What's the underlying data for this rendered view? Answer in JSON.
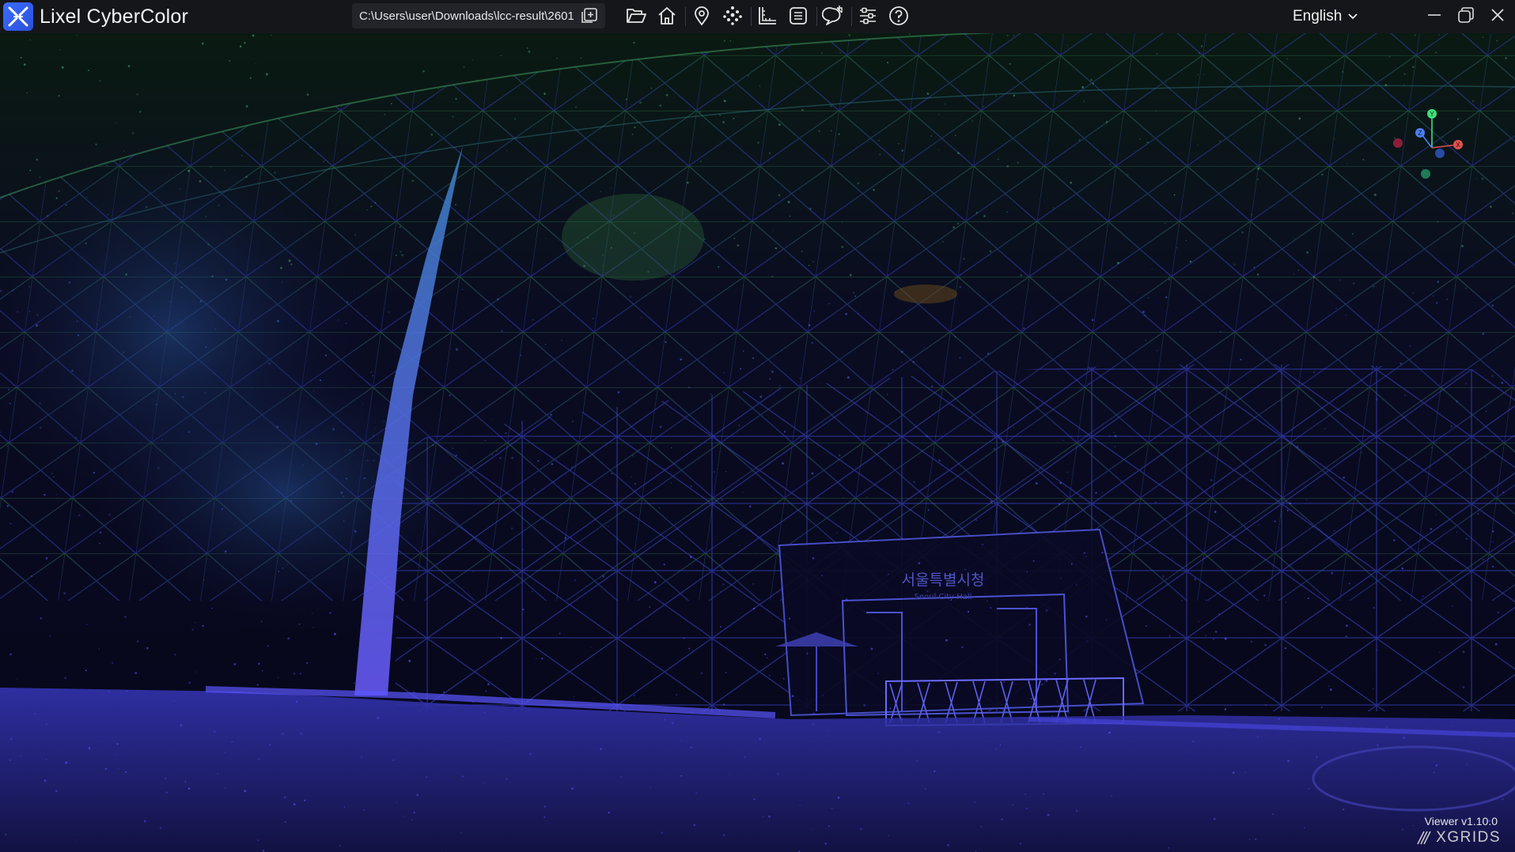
{
  "app": {
    "title": "Lixel CyberColor",
    "path": "C:\\Users\\user\\Downloads\\lcc-result\\2601",
    "language": "English"
  },
  "toolbar": {
    "icons": [
      "folder-open-icon",
      "home-icon",
      "location-pin-icon",
      "point-cloud-icon",
      "measure-ruler-icon",
      "list-icon",
      "chat-bubble-icon",
      "settings-sliders-icon",
      "help-icon"
    ]
  },
  "window": {
    "controls": [
      "minimize",
      "restore",
      "close"
    ]
  },
  "scene": {
    "sign_korean": "서울특별시청",
    "sign_english": "Seoul City Hall"
  },
  "gizmo": {
    "x": "X",
    "y": "Y",
    "z": "Z"
  },
  "footer": {
    "version": "Viewer v1.10.0",
    "brand": "XGRIDS"
  },
  "colors": {
    "titlebar": "#15161a",
    "accent": "#3b6dff",
    "pointcloud_low": "#4e47ff",
    "pointcloud_high": "#3aa86a"
  }
}
